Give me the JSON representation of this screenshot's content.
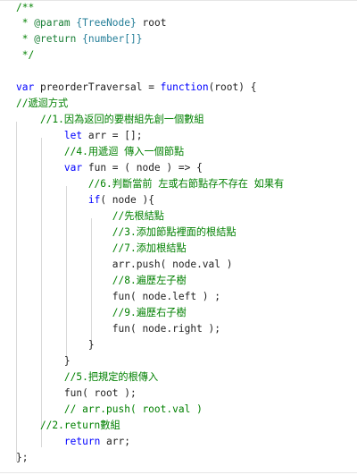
{
  "editor": {
    "language": "javascript",
    "lines": [
      "/**",
      " * @param {TreeNode} root",
      " * @return {number[]}",
      " */",
      "",
      "var preorderTraversal = function(root) {",
      "//遞迴方式",
      "    //1.因為返回的要樹組先創一個數組",
      "        let arr = [];",
      "        //4.用遞迴 傳入一個節點",
      "        var fun = ( node ) => {",
      "            //6.判斷當前 左或右節點存不存在 如果有",
      "            if( node ){",
      "                //先根結點",
      "                //3.添加節點裡面的根結點",
      "                //7.添加根結點",
      "                arr.push( node.val )",
      "                //8.遍歷左子樹",
      "                fun( node.left ) ;",
      "                //9.遍歷右子樹",
      "                fun( node.right );",
      "            }",
      "        }",
      "        //5.把規定的根傳入",
      "        fun( root );",
      "        // arr.push( root.val )",
      "    //2.return數組",
      "        return arr;",
      "};"
    ]
  },
  "colors": {
    "keyword": "#0000ff",
    "comment": "#008000",
    "text": "#1f1f1f",
    "guide": "#d9d9d9"
  }
}
